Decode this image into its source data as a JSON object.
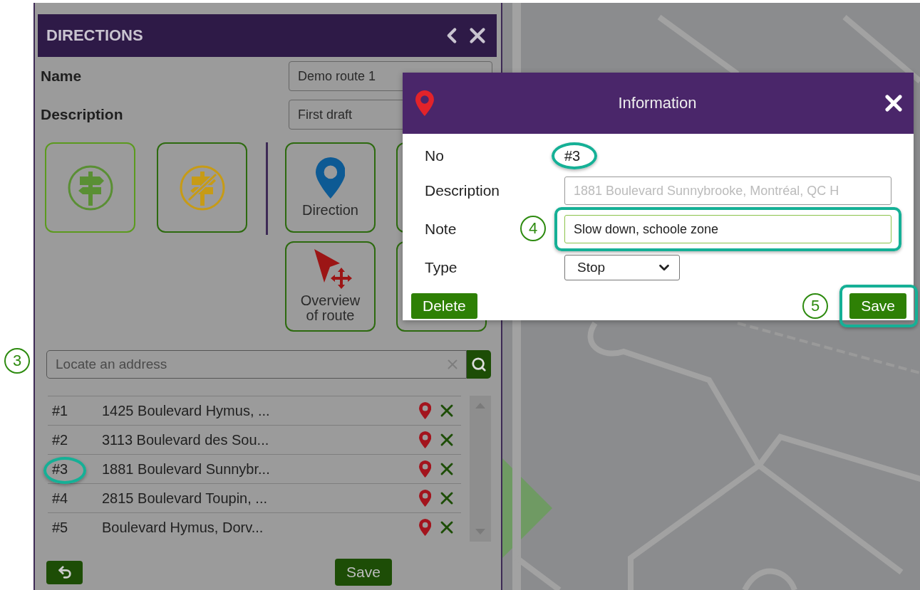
{
  "panel": {
    "title": "DIRECTIONS",
    "fields": [
      {
        "label": "Name",
        "value": "Demo route 1"
      },
      {
        "label": "Description",
        "value": "First draft"
      }
    ],
    "tools": [
      {
        "kind": "signpost"
      },
      {
        "kind": "no-signpost"
      },
      {
        "kind": "pin",
        "label": "Direction"
      },
      {
        "kind": "blank"
      },
      {
        "kind": "cursor",
        "label": "Overview of route"
      },
      {
        "kind": "blank"
      }
    ],
    "search": {
      "placeholder": "Locate an address",
      "callout": "3"
    },
    "stops": [
      {
        "number": "#1",
        "address": "1425 Boulevard Hymus, ...",
        "highlighted": false
      },
      {
        "number": "#2",
        "address": "3113 Boulevard des Sou...",
        "highlighted": false
      },
      {
        "number": "#3",
        "address": "1881 Boulevard Sunnybr...",
        "highlighted": true
      },
      {
        "number": "#4",
        "address": "2815 Boulevard Toupin, ...",
        "highlighted": false
      },
      {
        "number": "#5",
        "address": "Boulevard Hymus, Dorv...",
        "highlighted": false
      }
    ],
    "save": "Save"
  },
  "dialog": {
    "title": "Information",
    "no": {
      "label": "No",
      "value": "#3",
      "highlighted": true
    },
    "description": {
      "label": "Description",
      "value": "1881 Boulevard Sunnybrooke, Montréal, QC H",
      "disabled": true
    },
    "note": {
      "label": "Note",
      "value": "Slow down, schoole zone",
      "callout": "4",
      "highlighted": true
    },
    "type": {
      "label": "Type",
      "value": "Stop"
    },
    "delete": "Delete",
    "save": {
      "label": "Save",
      "callout": "5",
      "highlighted": true
    }
  }
}
